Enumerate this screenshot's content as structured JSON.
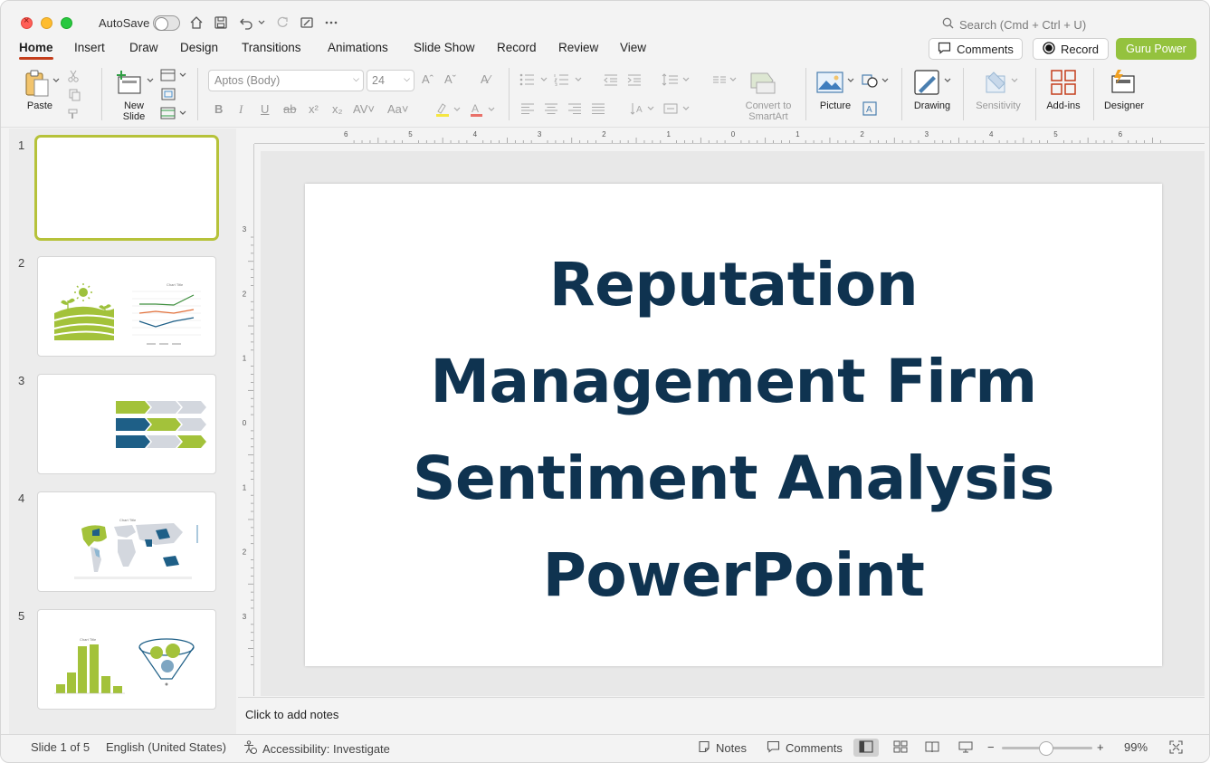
{
  "window": {
    "autosave_label": "AutoSave",
    "search_placeholder": "Search (Cmd + Ctrl + U)"
  },
  "tabs": [
    "Home",
    "Insert",
    "Draw",
    "Design",
    "Transitions",
    "Animations",
    "Slide Show",
    "Record",
    "Review",
    "View"
  ],
  "header_buttons": {
    "comments": "Comments",
    "record": "Record",
    "guru": "Guru Power"
  },
  "ribbon": {
    "paste": "Paste",
    "new_slide_line1": "New",
    "new_slide_line2": "Slide",
    "font_name": "Aptos (Body)",
    "font_size": "24",
    "convert_line1": "Convert to",
    "convert_line2": "SmartArt",
    "picture": "Picture",
    "drawing": "Drawing",
    "sensitivity": "Sensitivity",
    "addins": "Add-ins",
    "designer": "Designer"
  },
  "slides": {
    "numbers": [
      "1",
      "2",
      "3",
      "4",
      "5"
    ],
    "thumb_chart_title": "Chart Title",
    "current_title_lines": [
      "Reputation",
      "Management Firm",
      "Sentiment Analysis",
      "PowerPoint"
    ]
  },
  "notes_placeholder": "Click to add notes",
  "status": {
    "slide_of": "Slide 1 of 5",
    "language": "English (United States)",
    "accessibility": "Accessibility: Investigate",
    "notes": "Notes",
    "comments": "Comments",
    "zoom": "99%",
    "zoom_level": 0.5
  },
  "colors": {
    "accent_red": "#c43e1c",
    "guru_green": "#94c23e",
    "title_navy": "#0f3350",
    "thumb_green": "#a3c23a",
    "thumb_blue": "#1e5f87",
    "thumb_gray": "#d3d7de",
    "selection_border": "#b6c23a"
  }
}
